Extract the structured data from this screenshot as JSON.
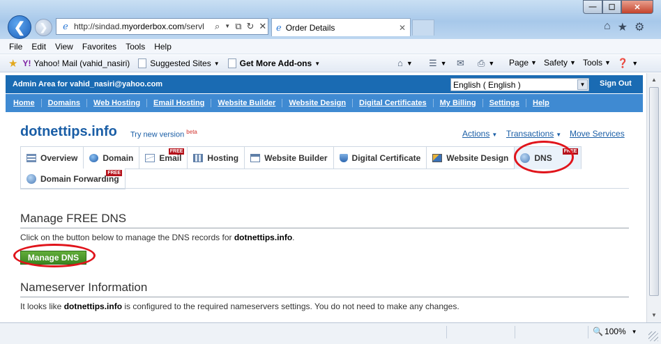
{
  "browser": {
    "back_glyph": "❮",
    "forward_glyph": "❯",
    "address": {
      "prefix": "http://sindad.",
      "domain": "myorderbox.com",
      "suffix": "/servl"
    },
    "tab_title": "Order Details",
    "menu": [
      "File",
      "Edit",
      "View",
      "Favorites",
      "Tools",
      "Help"
    ],
    "favorites": {
      "yahoo_label": "Yahoo! Mail (vahid_nasiri)",
      "suggested_label": "Suggested Sites",
      "addons_label": "Get More Add-ons"
    },
    "commands": {
      "page": "Page",
      "safety": "Safety",
      "tools": "Tools"
    }
  },
  "admin": {
    "area_label": "Admin Area for vahid_nasiri@yahoo.com",
    "language": "English ( English )",
    "sign_out": "Sign Out",
    "nav": [
      "Home",
      "Domains",
      "Web Hosting",
      "Email Hosting",
      "Website Builder",
      "Website Design",
      "Digital Certificates",
      "My Billing",
      "Settings",
      "Help"
    ]
  },
  "domain": {
    "name": "dotnettips.info",
    "try_new": "Try new version",
    "beta": "beta",
    "actions": "Actions",
    "transactions": "Transactions",
    "move_services": "Move Services",
    "free_badge": "FREE",
    "tabs": [
      {
        "label": "Overview",
        "icon": "grid-icon"
      },
      {
        "label": "Domain",
        "icon": "globe-icon"
      },
      {
        "label": "Email",
        "icon": "mail-icon",
        "free": true
      },
      {
        "label": "Hosting",
        "icon": "server-icon"
      },
      {
        "label": "Website Builder",
        "icon": "web-icon"
      },
      {
        "label": "Digital Certificate",
        "icon": "shield-icon"
      },
      {
        "label": "Website Design",
        "icon": "design-icon"
      },
      {
        "label": "DNS",
        "icon": "dns-icon",
        "free": true,
        "selected": true
      },
      {
        "label": "Domain Forwarding",
        "icon": "forward-icon",
        "free": true
      }
    ]
  },
  "dns": {
    "heading": "Manage FREE DNS",
    "instruction_prefix": "Click on the button below to manage the DNS records for ",
    "instruction_domain": "dotnettips.info",
    "instruction_suffix": ".",
    "button": "Manage DNS"
  },
  "nameserver": {
    "heading": "Nameserver Information",
    "text_prefix": "It looks like ",
    "text_domain": "dotnettips.info",
    "text_suffix": " is configured to the required nameservers settings. You do not need to make any changes."
  },
  "status": {
    "zoom": "100%"
  },
  "colors": {
    "admin_bar": "#1a6bb3",
    "nav_bar": "#3f8ad2",
    "link": "#1a5ea6",
    "button_green": "#4c9a2c",
    "highlight_ring": "#e0141b",
    "free_badge": "#b5121b"
  }
}
